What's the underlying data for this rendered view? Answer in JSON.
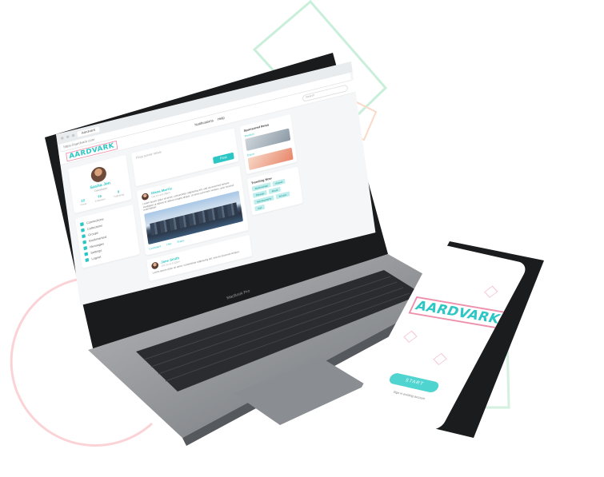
{
  "brand": {
    "name": "AARDVARK",
    "accent": "#2cc7c4",
    "pink": "#ee8fab",
    "green_outline": "#bdecd3"
  },
  "browser": {
    "tab_label": "Aardvark",
    "address": "https://aardvark.com"
  },
  "app_header": {
    "nav": [
      "Notifications",
      "Help"
    ],
    "search_placeholder": "Search"
  },
  "profile": {
    "name": "Sasha Jen",
    "subtitle": "Developer",
    "stats": [
      {
        "value": "22",
        "label": "Posts"
      },
      {
        "value": "76",
        "label": "Followers"
      },
      {
        "value": "9",
        "label": "Following"
      }
    ]
  },
  "menu": [
    "Connections",
    "Collections",
    "Groups",
    "Bookmarked",
    "Messages",
    "Settings",
    "Logout"
  ],
  "composer": {
    "placeholder": "Post some news",
    "button": "Post"
  },
  "posts": [
    {
      "author": "Diana Morris",
      "time": "Oct 14 at 6:32pm",
      "text": "Lorem ipsum dolor sit amet, consectetur adipiscing elit, sed do eiusmod tempor incididunt ut labore et dolore magna aliqua. Ut enim ad minim veniam, quis nostrud exercitation.",
      "actions": [
        "Comment",
        "Like",
        "Share"
      ]
    },
    {
      "author": "Jane Smith",
      "time": "Oct 14 at 5:12pm",
      "text": "Lorem ipsum dolor sit amet, consectetur adipiscing elit, sed do eiusmod tempor."
    }
  ],
  "sponsored": {
    "title": "Sponsored Items",
    "items": [
      "Product",
      "Event"
    ]
  },
  "trending": {
    "title": "Trending Now",
    "tags": [
      "#technology",
      "#travel",
      "#design",
      "#food",
      "#photography",
      "#music",
      "#art"
    ]
  },
  "laptop": {
    "model_label": "MacBook Pro"
  },
  "phone": {
    "logo": "AARDVARK",
    "start_button": "START",
    "signin_text": "Sign in existing account"
  }
}
